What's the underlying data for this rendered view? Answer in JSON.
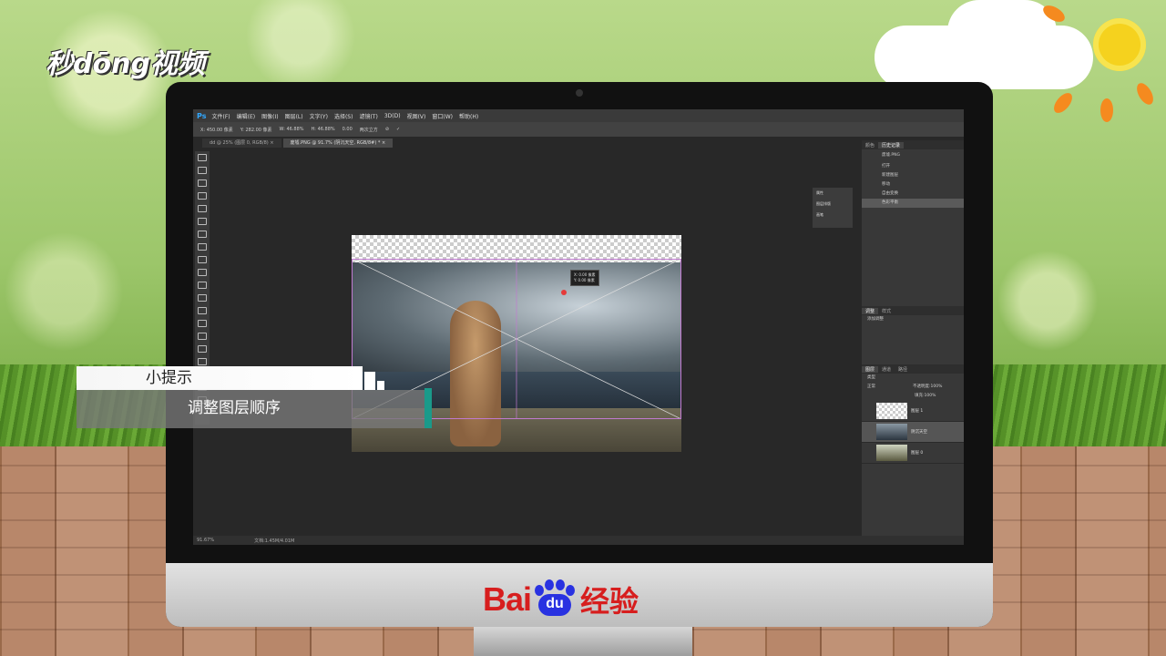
{
  "watermark": {
    "logo_text": "秒dōng视频"
  },
  "photoshop": {
    "app_logo": "Ps",
    "menu": [
      "文件(F)",
      "编辑(E)",
      "图像(I)",
      "图层(L)",
      "文字(Y)",
      "选择(S)",
      "滤镜(T)",
      "3D(D)",
      "视图(V)",
      "窗口(W)",
      "帮助(H)"
    ],
    "options": {
      "x": "X: 450.00 像素",
      "y": "Y: 282.00 像素",
      "w": "W: 46.88%",
      "h": "H: 46.88%",
      "angle": "0.00",
      "interp": "两次立方"
    },
    "tabs": [
      {
        "label": "dd @ 25% (图层 0, RGB/8) ×"
      },
      {
        "label": "废墟.PNG @ 91.7% (阴沉天空, RGB/8#) * ×"
      }
    ],
    "tooltip": {
      "line1": "X: 0.00 像素",
      "line2": "Y: 0.00 像素"
    },
    "mini_panel": [
      "属性",
      "图层排版",
      "画笔"
    ],
    "history": {
      "tabs": [
        "颜色",
        "历史记录"
      ],
      "snapshot": "废墟.PNG",
      "items": [
        "打开",
        "新建图层",
        "移动",
        "自由变换",
        "色彩平衡"
      ]
    },
    "adjustments": {
      "tabs": [
        "调整",
        "样式"
      ],
      "hint": "添加调整"
    },
    "layers": {
      "tabs": [
        "图层",
        "通道",
        "路径"
      ],
      "kind": "类型",
      "blend": "正常",
      "opacity_label": "不透明度:",
      "opacity": "100%",
      "fill_label": "填充:",
      "fill": "100%",
      "items": [
        {
          "name": "图层 1"
        },
        {
          "name": "阴沉天空"
        },
        {
          "name": "图层 0"
        }
      ]
    },
    "status": {
      "zoom": "91.67%",
      "doc": "文档:1.45M/4.01M"
    }
  },
  "tip": {
    "title": "小提示",
    "text": "调整图层顺序"
  },
  "baidu": {
    "brand_left": "Bai",
    "brand_paw": "du",
    "brand_right": "经验"
  }
}
